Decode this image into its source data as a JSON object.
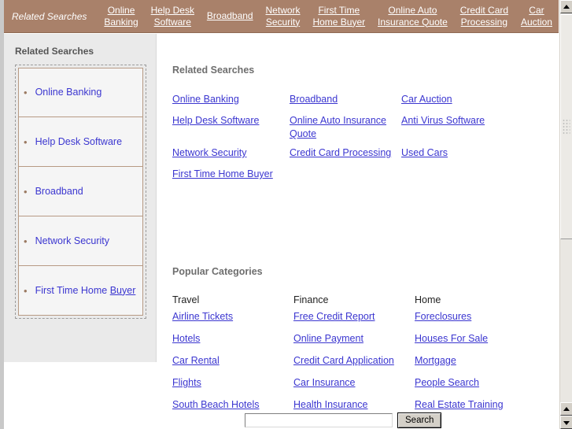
{
  "navbar": {
    "title": "Related Searches",
    "links": [
      "Online\nBanking",
      "Help Desk\nSoftware",
      "Broadband",
      "Network\nSecurity",
      "First Time\nHome Buyer",
      "Online Auto\nInsurance Quote",
      "Credit Card\nProcessing",
      "Car\nAuction"
    ],
    "background_color": "#a9816a",
    "link_color": "#ffffff"
  },
  "sidebar": {
    "title": "Related Searches",
    "bullet": "•",
    "items": [
      {
        "label": "Online Banking"
      },
      {
        "label": "Help Desk Software"
      },
      {
        "label": "Broadband"
      },
      {
        "label": "Network Security"
      },
      {
        "label": "First Time Home ",
        "label_underlined": "Buyer"
      }
    ]
  },
  "main": {
    "related_searches": {
      "title": "Related Searches",
      "columns": [
        [
          "Online Banking",
          "Help Desk Software",
          "Network Security",
          "First Time Home Buyer"
        ],
        [
          "Broadband",
          "Online Auto Insurance Quote",
          "Credit Card Processing"
        ],
        [
          "Car Auction",
          "Anti Virus Software",
          "Used Cars"
        ]
      ]
    },
    "popular_categories": {
      "title": "Popular Categories",
      "columns": [
        {
          "heading": "Travel",
          "items": [
            "Airline Tickets",
            "Hotels",
            "Car Rental",
            "Flights",
            "South Beach Hotels"
          ]
        },
        {
          "heading": "Finance",
          "items": [
            "Free Credit Report",
            "Online Payment",
            "Credit Card Application",
            "Car Insurance",
            "Health Insurance"
          ]
        },
        {
          "heading": "Home",
          "items": [
            "Foreclosures",
            "Houses For Sale",
            "Mortgage",
            "People Search",
            "Real Estate Training"
          ]
        }
      ]
    }
  },
  "search": {
    "value": "",
    "placeholder": "",
    "button_label": "Search"
  },
  "colors": {
    "link": "#3b36d0",
    "heading": "#6e6e6e",
    "accent_brown": "#a9816a",
    "sidebar_bg": "#eaeaea"
  }
}
